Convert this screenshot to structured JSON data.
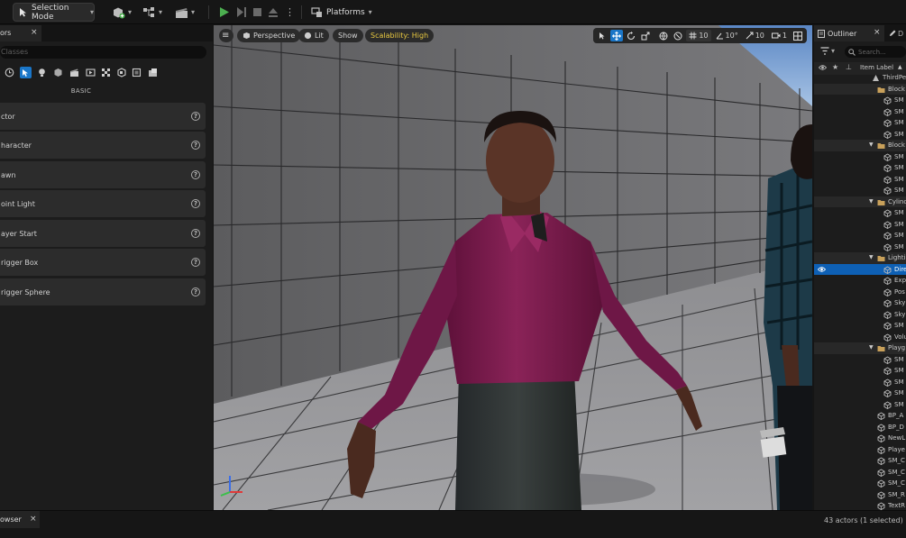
{
  "toolbar": {
    "selection_mode": "Selection Mode",
    "platforms": "Platforms"
  },
  "left_panel": {
    "tab_label": "ors",
    "search_placeholder": "Classes",
    "category_heading": "BASIC",
    "items": [
      {
        "label": "ctor"
      },
      {
        "label": "haracter"
      },
      {
        "label": "awn"
      },
      {
        "label": "oint Light"
      },
      {
        "label": "ayer Start"
      },
      {
        "label": "rigger Box"
      },
      {
        "label": "rigger Sphere"
      }
    ]
  },
  "viewport": {
    "perspective": "Perspective",
    "lit": "Lit",
    "show": "Show",
    "scalability": "Scalability: High",
    "grid_snap": "10",
    "angle_snap": "10°",
    "scale_snap": "10",
    "camera_speed": "1"
  },
  "outliner": {
    "tab_label": "Outliner",
    "tab2_label": "D",
    "search_placeholder": "Search...",
    "item_label_header": "Item Label",
    "rows": [
      {
        "label": "ThirdPe"
      },
      {
        "label": "Block"
      },
      {
        "label": "SM"
      },
      {
        "label": "SM"
      },
      {
        "label": "SM"
      },
      {
        "label": "SM"
      },
      {
        "label": "Block"
      },
      {
        "label": "SM"
      },
      {
        "label": "SM"
      },
      {
        "label": "SM"
      },
      {
        "label": "SM"
      },
      {
        "label": "Cylinc"
      },
      {
        "label": "SM"
      },
      {
        "label": "SM"
      },
      {
        "label": "SM"
      },
      {
        "label": "SM"
      },
      {
        "label": "Lightin"
      },
      {
        "label": "Dire"
      },
      {
        "label": "Exp"
      },
      {
        "label": "Pos"
      },
      {
        "label": "Sky"
      },
      {
        "label": "Sky"
      },
      {
        "label": "SM"
      },
      {
        "label": "Volu"
      },
      {
        "label": "Playg"
      },
      {
        "label": "SM"
      },
      {
        "label": "SM"
      },
      {
        "label": "SM"
      },
      {
        "label": "SM"
      },
      {
        "label": "SM"
      },
      {
        "label": "BP_A"
      },
      {
        "label": "BP_D"
      },
      {
        "label": "NewL"
      },
      {
        "label": "Playe"
      },
      {
        "label": "SM_C"
      },
      {
        "label": "SM_C"
      },
      {
        "label": "SM_C"
      },
      {
        "label": "SM_R"
      },
      {
        "label": "TextR"
      }
    ],
    "status": "43 actors (1 selected)"
  },
  "bottom": {
    "content_browser_tab": "owser"
  },
  "colors": {
    "accent_blue": "#1a76c8",
    "selected_row": "#0e60b5",
    "play_green": "#4caf50",
    "scalability_yellow": "#e8c840",
    "folder_orange": "#c8a05a",
    "shirt_magenta": "#7a1a4e"
  },
  "icons": {
    "add_actor": "add-actor-icon",
    "play": "play-icon",
    "platforms": "platforms-icon",
    "hamburger": "menu-icon"
  }
}
